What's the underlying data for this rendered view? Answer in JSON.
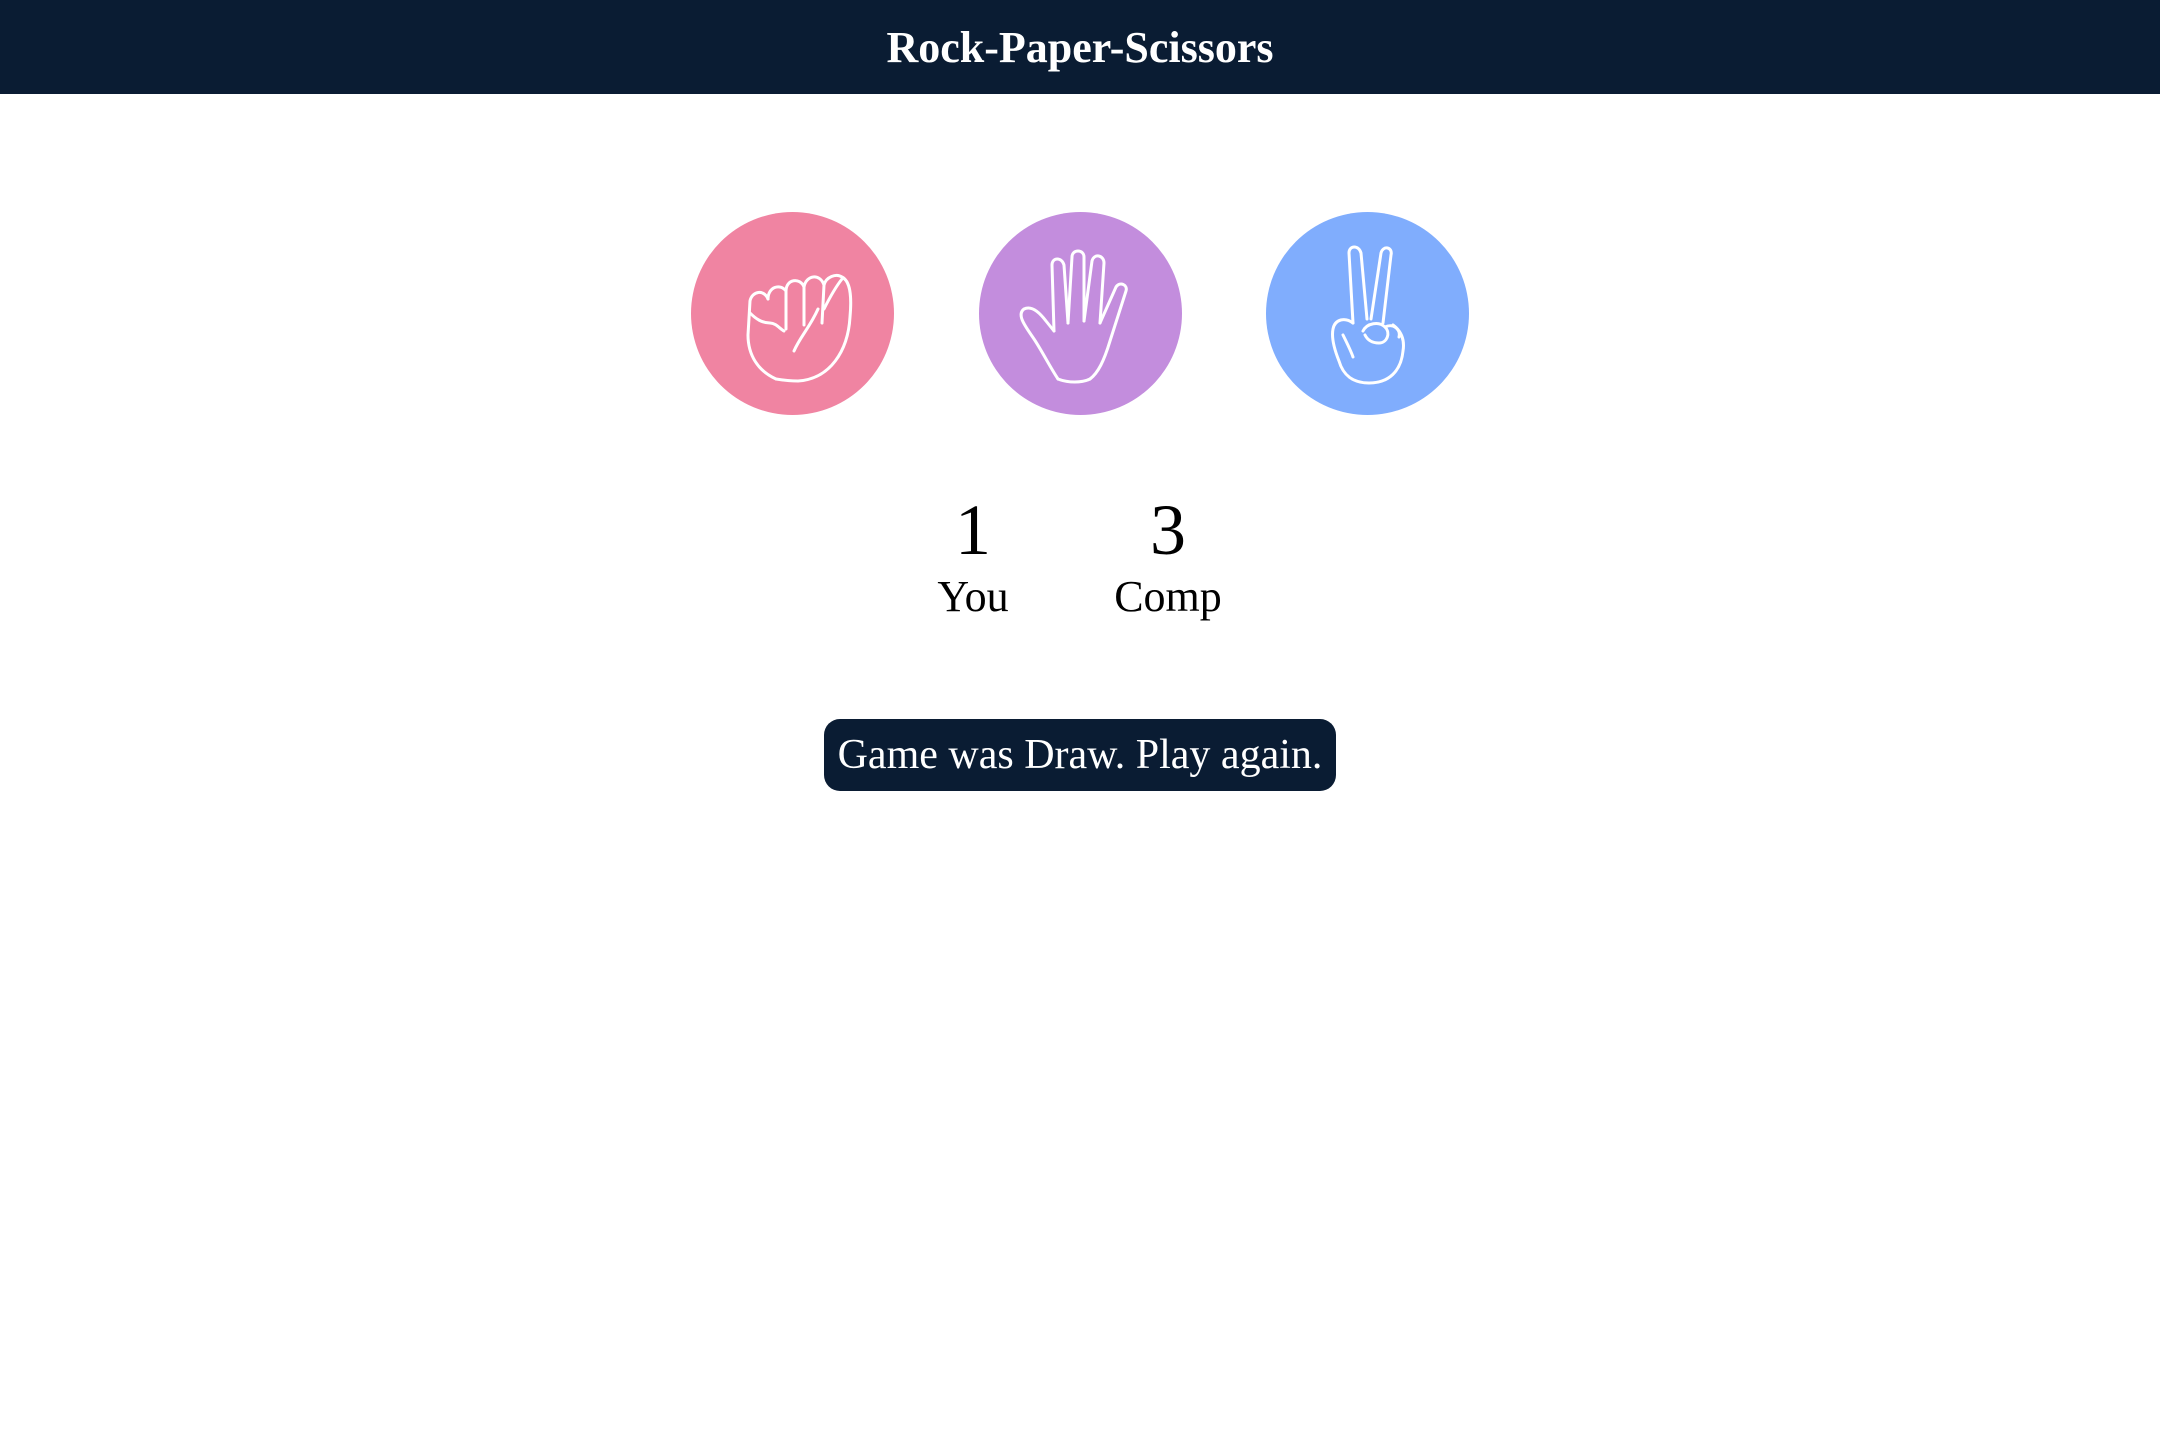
{
  "header": {
    "title": "Rock-Paper-Scissors",
    "background": "#0a1c33"
  },
  "choices": [
    {
      "id": "rock",
      "icon": "fist-icon",
      "color": "#f084a2"
    },
    {
      "id": "paper",
      "icon": "open-hand-icon",
      "color": "#c38ddd"
    },
    {
      "id": "scissors",
      "icon": "peace-sign-icon",
      "color": "#80adfd"
    }
  ],
  "scoreboard": {
    "user_score": "1",
    "user_label": "You",
    "comp_score": "3",
    "comp_label": "Comp"
  },
  "message": {
    "text": "Game was Draw. Play again.",
    "background": "#0a1c33"
  }
}
